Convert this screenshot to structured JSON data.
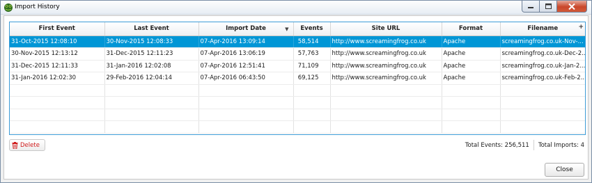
{
  "window": {
    "title": "Import History",
    "icon": "frog-icon",
    "controls": [
      "minimize-icon",
      "maximize-icon",
      "close-icon"
    ]
  },
  "table": {
    "columns": [
      "First Event",
      "Last Event",
      "Import Date",
      "Events",
      "Site URL",
      "Format",
      "Filename"
    ],
    "sorted_column": "Import Date",
    "sort_direction": "descending",
    "rows": [
      [
        "31-Oct-2015 12:08:10",
        "30-Nov-2015 12:08:33",
        "07-Apr-2016 13:09:14",
        "58,514",
        "http://www.screamingfrog.co.uk",
        "Apache",
        "screamingfrog.co.uk-Nov-..."
      ],
      [
        "30-Nov-2015 12:13:12",
        "31-Dec-2015 12:11:23",
        "07-Apr-2016 13:06:19",
        "57,763",
        "http://www.screamingfrog.co.uk",
        "Apache",
        "screamingfrog.co.uk-Dec-2..."
      ],
      [
        "31-Dec-2015 12:11:33",
        "31-Jan-2016 12:02:08",
        "07-Apr-2016 12:51:41",
        "71,109",
        "http://www.screamingfrog.co.uk",
        "Apache",
        "screamingfrog.co.uk-Jan-2..."
      ],
      [
        "31-Jan-2016 12:02:30",
        "29-Feb-2016 12:04:14",
        "07-Apr-2016 06:43:50",
        "69,125",
        "http://www.screamingfrog.co.uk",
        "Apache",
        "screamingfrog.co.uk-Feb-2..."
      ]
    ],
    "selected_row": 0
  },
  "footer": {
    "delete_label": "Delete",
    "total_events": "Total Events: 256,511",
    "total_imports": "Total Imports: 4",
    "close_label": "Close"
  },
  "colors": {
    "selection": "#0096d6",
    "delete_text": "#d01a1a",
    "frame_border": "#3c9bd6"
  }
}
